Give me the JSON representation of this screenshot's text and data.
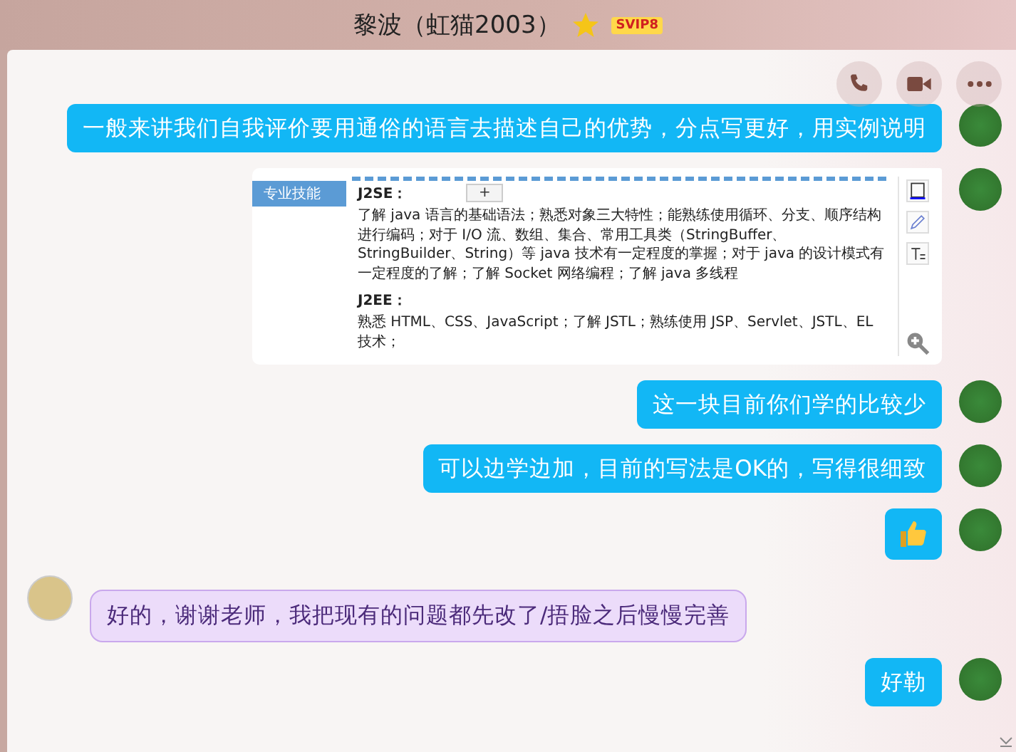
{
  "window": {
    "title": "黎波（虹猫2003）",
    "vip_badge": "SVIP8"
  },
  "messages": [
    {
      "kind": "text",
      "outgoing": true,
      "text": "一般来讲我们自我评价要用通俗的语言去描述自己的优势，分点写更好，用实例说明"
    },
    {
      "kind": "document",
      "outgoing": true,
      "section_label": "专业技能",
      "blocks": [
        {
          "heading": "J2SE：",
          "body": "了解 java 语言的基础语法；熟悉对象三大特性；能熟练使用循环、分支、顺序结构进行编码；对于 I/O 流、数组、集合、常用工具类（StringBuffer、StringBuilder、String）等 java 技术有一定程度的掌握；对于 java 的设计模式有一定程度的了解；了解 Socket 网络编程；了解 java 多线程"
        },
        {
          "heading": "J2EE：",
          "body": "熟悉 HTML、CSS、JavaScript；了解 JSTL；熟练使用 JSP、Servlet、JSTL、EL 技术；"
        }
      ],
      "overlay_button": "+"
    },
    {
      "kind": "text",
      "outgoing": true,
      "text": "这一块目前你们学的比较少"
    },
    {
      "kind": "text",
      "outgoing": true,
      "text": "可以边学边加，目前的写法是OK的，写得很细致"
    },
    {
      "kind": "emoji",
      "outgoing": true
    },
    {
      "kind": "text",
      "outgoing": false,
      "text": "好的，谢谢老师，我把现有的问题都先改了/捂脸之后慢慢完善"
    },
    {
      "kind": "text",
      "outgoing": true,
      "text": "好勒"
    }
  ]
}
